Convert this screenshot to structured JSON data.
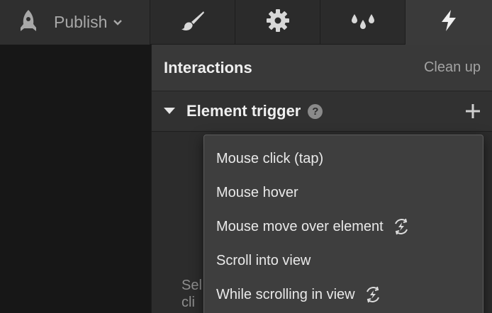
{
  "topbar": {
    "publish_label": "Publish",
    "tabs": [
      {
        "name": "style",
        "icon": "brush-icon"
      },
      {
        "name": "settings",
        "icon": "gear-icon"
      },
      {
        "name": "style-manager",
        "icon": "drops-icon"
      },
      {
        "name": "interactions",
        "icon": "lightning-icon",
        "active": true
      }
    ]
  },
  "panel": {
    "title": "Interactions",
    "cleanup_label": "Clean up",
    "trigger": {
      "title": "Element trigger",
      "help": "?"
    },
    "hint_text": "Sel cli"
  },
  "dropdown": {
    "items": [
      {
        "label": "Mouse click (tap)",
        "badge": false
      },
      {
        "label": "Mouse hover",
        "badge": false
      },
      {
        "label": "Mouse move over element",
        "badge": true
      },
      {
        "label": "Scroll into view",
        "badge": false
      },
      {
        "label": "While scrolling in view",
        "badge": true
      }
    ]
  },
  "colors": {
    "background": "#171717",
    "panel": "#2c2c2c",
    "header": "#393939",
    "dropdown": "#3e3e3e",
    "text": "#e9e9e9",
    "muted": "#a3a3a3"
  }
}
